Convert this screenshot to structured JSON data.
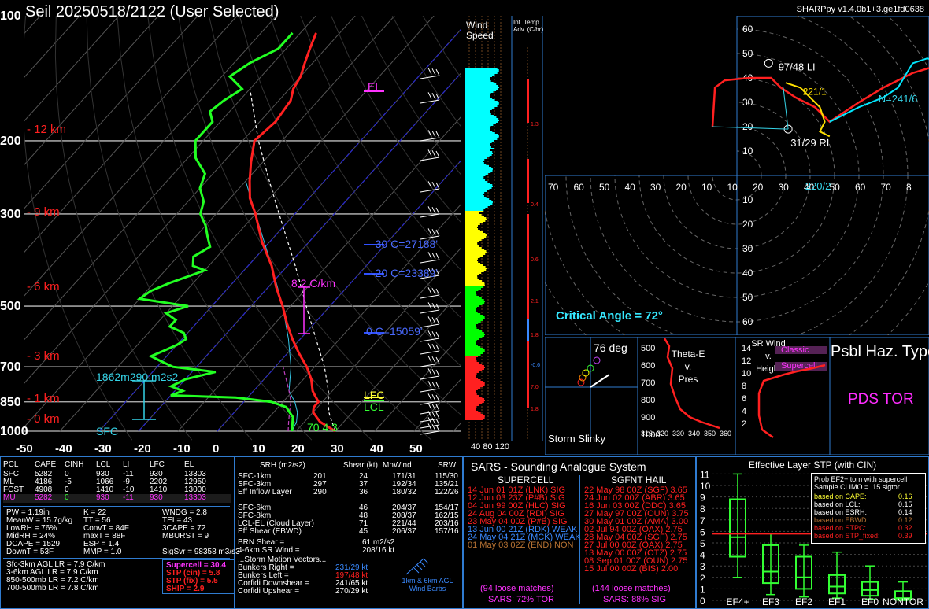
{
  "header": {
    "title": "Seil   20250518/2122  (User Selected)",
    "version": "SHARPpy v1.4.0b1+3.ge1fd0638",
    "top_pressure": "100"
  },
  "skewt": {
    "pressure_labels": [
      "200",
      "300",
      "500",
      "700",
      "850",
      "1000"
    ],
    "height_labels": [
      "12 km",
      "9 km",
      "6 km",
      "3 km",
      "1 km",
      "0 km"
    ],
    "temp_ticks": [
      "-50",
      "-40",
      "-30",
      "-20",
      "-10",
      "0",
      "10",
      "20",
      "30",
      "40",
      "50"
    ],
    "el_label": "EL",
    "lfc_label": "LFC",
    "lcl_label": "LCL",
    "lapse_label": "8.2 C/km",
    "isotherm_labels": [
      "-30 C=27188'",
      "-20 C=23389'",
      "0 C=15059'"
    ],
    "srh_label": "1862m290 m2s2",
    "sfc_label": "SFC",
    "sfc_values": "70 4 3"
  },
  "wind_speed": {
    "title": "Wind Speed",
    "ticks": "40 80 120"
  },
  "inferred_temp": {
    "title": "Inf. Temp. Adv. (C/hr)",
    "values": [
      "1.3",
      "0.4",
      "0.6",
      "2.1",
      "1.8",
      "-0.6",
      "7.0",
      "1.8"
    ]
  },
  "hodograph": {
    "ticks_y": [
      "60",
      "50",
      "40",
      "30",
      "20",
      "10",
      "10",
      "20",
      "30",
      "40",
      "50",
      "60"
    ],
    "ticks_x": [
      "70",
      "60",
      "50",
      "40",
      "30",
      "20",
      "10",
      "10",
      "20",
      "30",
      "40",
      "50",
      "60",
      "70",
      "8"
    ],
    "lm_label": "97/48 LI",
    "rm_label": "31/29 RI",
    "mean_label": "N=241/6",
    "sr_label": "220/2",
    "partial_label": "221/1",
    "critical_angle": "Critical Angle = 72°"
  },
  "slinky": {
    "label": "Storm Slinky",
    "deg": "76 deg"
  },
  "theta": {
    "title_lines": [
      "Theta-E",
      "v.",
      "Pres"
    ],
    "y_ticks": [
      "500",
      "600",
      "700",
      "800",
      "900",
      "1000"
    ],
    "x_ticks": [
      "316",
      "320",
      "330",
      "340",
      "350",
      "360"
    ]
  },
  "srwind": {
    "title_lines": [
      "SR Wind",
      "v.",
      "Height"
    ],
    "y_ticks": [
      "14",
      "12",
      "10",
      "8",
      "6",
      "4",
      "2"
    ],
    "classic": "Classic",
    "supercell": "Supercell"
  },
  "hazard": {
    "title": "Psbl Haz. Type",
    "value": "PDS TOR"
  },
  "parcels": {
    "headers": [
      "PCL",
      "CAPE",
      "CINH",
      "LCL",
      "LI",
      "LFC",
      "EL"
    ],
    "rows": [
      [
        "SFC",
        "5282",
        "0",
        "930",
        "-11",
        "930",
        "13303"
      ],
      [
        "ML",
        "4186",
        "-5",
        "1066",
        "-9",
        "2202",
        "12950"
      ],
      [
        "FCST",
        "4908",
        "0",
        "1410",
        "-10",
        "1410",
        "13000"
      ],
      [
        "MU",
        "5282",
        "0",
        "930",
        "-11",
        "930",
        "13303"
      ]
    ],
    "indices_left": [
      "PW = 1.19in",
      "MeanW = 15.7g/kg",
      "LowRH = 76%",
      "MidRH = 24%",
      "DCAPE = 1529",
      "DownT = 53F"
    ],
    "indices_mid": [
      "K = 22",
      "TT = 56",
      "ConvT = 84F",
      "maxT = 88F",
      "ESP = 1.4",
      "MMP = 1.0"
    ],
    "indices_right": [
      "WNDG = 2.8",
      "TEI = 43",
      "3CAPE = 72",
      "MBURST = 9",
      "",
      "SigSvr = 98358 m3/s3"
    ],
    "lapse": [
      "Sfc-3km AGL LR = 7.9 C/km",
      "3-6km AGL LR = 7.9 C/km",
      "850-500mb LR = 7.2 C/km",
      "700-500mb LR = 7.8 C/km"
    ],
    "composites": [
      "Supercell = 30.4",
      "STP (cin) = 5.8",
      "STP (fix) = 5.5",
      "SHIP = 2.9"
    ]
  },
  "kinematics": {
    "headers": [
      "SRH (m2/s2)",
      "Shear (kt)",
      "MnWind",
      "SRW"
    ],
    "rows": [
      [
        "SFC-1km",
        "201",
        "24",
        "171/31",
        "115/30"
      ],
      [
        "SFC-3km",
        "297",
        "37",
        "192/34",
        "135/21"
      ],
      [
        "Eff Inflow Layer",
        "290",
        "36",
        "180/32",
        "122/26"
      ],
      [
        "",
        "",
        "",
        "",
        ""
      ],
      [
        "SFC-6km",
        "",
        "46",
        "204/37",
        "154/17"
      ],
      [
        "SFC-8km",
        "",
        "48",
        "208/37",
        "162/15"
      ],
      [
        "LCL-EL (Cloud Layer)",
        "",
        "71",
        "221/44",
        "203/16"
      ],
      [
        "Eff Shear (EBWD)",
        "",
        "45",
        "206/37",
        "157/16"
      ]
    ],
    "brn": "BRN Shear =",
    "brn_val": "61 m2/s2",
    "srwind46": "4-6km SR Wind =",
    "srwind46_val": "208/16 kt",
    "motion_title": "...Storm Motion Vectors...",
    "motions": [
      [
        "Bunkers Right =",
        "231/29 kt"
      ],
      [
        "Bunkers Left =",
        "197/48 kt"
      ],
      [
        "Corfidi Downshear =",
        "241/65 kt"
      ],
      [
        "Corfidi Upshear =",
        "270/29 kt"
      ]
    ],
    "barb_label": "1km & 6km AGL Wind Barbs"
  },
  "sars": {
    "title": "SARS - Sounding Analogue System",
    "supercell_header": "SUPERCELL",
    "hail_header": "SGFNT HAIL",
    "supercell_rows": [
      "14 Jun 01 01Z (LNK) SIG",
      "12 Jun 03 23Z (P#B) SIG",
      "04 Jun 99 00Z (HLC) SIG",
      "24 Aug 04 00Z (RDI) SIG",
      "23 May 04 00Z (P#B) SIG",
      "13 Jun 00 21Z (RDK) WEAK",
      "24 May 04 21Z (MCK) WEAK",
      "01 May 03 02Z (END) NON"
    ],
    "hail_rows": [
      "22 May 98 00Z (SGF) 3.65",
      "24 Jun 02 00Z (ABR) 3.65",
      "16 Jun 03 00Z (DDC) 3.65",
      "27 May 97 00Z (OUN) 3.75",
      "30 May 01 00Z (AMA) 3.00",
      "02 Jul 94 00Z (OAX) 2.75",
      "28 May 04 00Z (SGF) 2.75",
      "27 Jul 00 00Z (OAX) 2.75",
      "13 May 00 00Z (OTZ) 2.75",
      "08 Sep 01 00Z (OUN) 2.75",
      "15 Jul 00 00Z (BIS) 2.00"
    ],
    "supercell_matches": "(94 loose matches)",
    "supercell_sars": "SARS: 72% TOR",
    "hail_matches": "(144 loose matches)",
    "hail_sars": "SARS: 88% SIG"
  },
  "stp": {
    "title": "Effective Layer STP (with CIN)",
    "y_ticks": [
      "11",
      "10",
      "9",
      "8",
      "7",
      "6",
      "5",
      "4",
      "3",
      "2",
      "1",
      "0"
    ],
    "x_labels": [
      "EF4+",
      "EF3",
      "EF2",
      "EF1",
      "EF0",
      "NONTOR"
    ],
    "legend_title": "Prob EF2+ torn with supercell",
    "legend_sub": "Sample CLIMO = .15 sigtor",
    "legend_rows": [
      [
        "based on CAPE:",
        "0.16"
      ],
      [
        "based on LCL:",
        "0.15"
      ],
      [
        "based on ESRH:",
        "0.14"
      ],
      [
        "based on EBWD:",
        "0.12"
      ],
      [
        "based on STPC:",
        "0.32"
      ],
      [
        "based on STP_fixed:",
        "0.39"
      ]
    ]
  }
}
